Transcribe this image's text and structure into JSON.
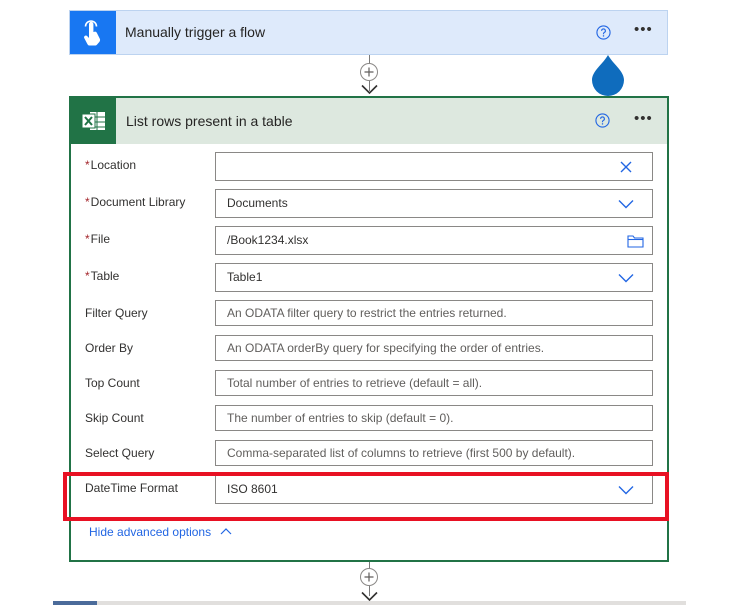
{
  "trigger": {
    "title": "Manually trigger a flow",
    "icon": "touch-hand-icon",
    "accent_color": "#1877f2"
  },
  "action": {
    "title": "List rows present in a table",
    "icon": "excel-icon",
    "accent_color": "#217346",
    "fields": [
      {
        "label": "Location",
        "required": true,
        "value": "",
        "placeholder": "",
        "icon": "clear-x-icon"
      },
      {
        "label": "Document Library",
        "required": true,
        "value": "Documents",
        "placeholder": "",
        "icon": "chevron-down-icon"
      },
      {
        "label": "File",
        "required": true,
        "value": "/Book1234.xlsx",
        "placeholder": "",
        "icon": "folder-icon"
      },
      {
        "label": "Table",
        "required": true,
        "value": "Table1",
        "placeholder": "",
        "icon": "chevron-down-icon"
      },
      {
        "label": "Filter Query",
        "required": false,
        "value": "",
        "placeholder": "An ODATA filter query to restrict the entries returned."
      },
      {
        "label": "Order By",
        "required": false,
        "value": "",
        "placeholder": "An ODATA orderBy query for specifying the order of entries."
      },
      {
        "label": "Top Count",
        "required": false,
        "value": "",
        "placeholder": "Total number of entries to retrieve (default = all)."
      },
      {
        "label": "Skip Count",
        "required": false,
        "value": "",
        "placeholder": "The number of entries to skip (default = 0)."
      },
      {
        "label": "Select Query",
        "required": false,
        "value": "",
        "placeholder": "Comma-separated list of columns to retrieve (first 500 by default)."
      },
      {
        "label": "DateTime Format",
        "required": false,
        "value": "ISO 8601",
        "placeholder": "",
        "icon": "chevron-down-icon"
      }
    ],
    "hide_advanced_label": "Hide advanced options",
    "required_marker": "*"
  },
  "highlight_color": "#e81123"
}
